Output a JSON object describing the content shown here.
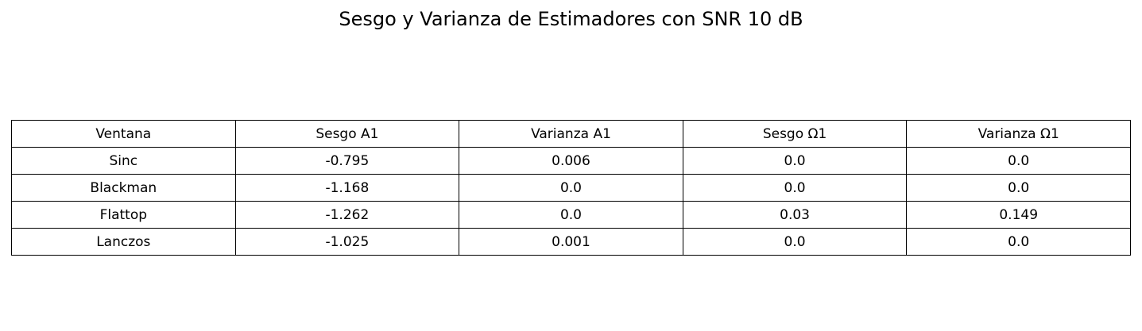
{
  "chart_data": {
    "type": "table",
    "title": "Sesgo y Varianza de Estimadores con SNR 10 dB",
    "columns": [
      "Ventana",
      "Sesgo A1",
      "Varianza A1",
      "Sesgo Ω1",
      "Varianza Ω1"
    ],
    "rows": [
      [
        "Sinc",
        "-0.795",
        "0.006",
        "0.0",
        "0.0"
      ],
      [
        "Blackman",
        "-1.168",
        "0.0",
        "0.0",
        "0.0"
      ],
      [
        "Flattop",
        "-1.262",
        "0.0",
        "0.03",
        "0.149"
      ],
      [
        "Lanczos",
        "-1.025",
        "0.001",
        "0.0",
        "0.0"
      ]
    ]
  }
}
